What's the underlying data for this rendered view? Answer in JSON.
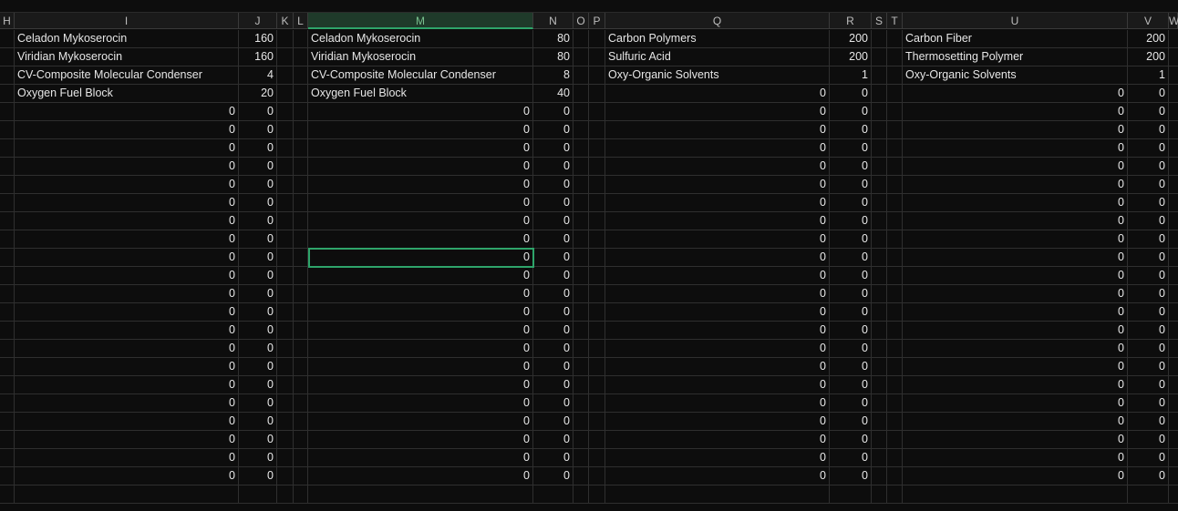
{
  "columns": [
    {
      "letter": "H",
      "active": false
    },
    {
      "letter": "I",
      "active": false
    },
    {
      "letter": "J",
      "active": false
    },
    {
      "letter": "K",
      "active": false
    },
    {
      "letter": "L",
      "active": false
    },
    {
      "letter": "M",
      "active": true
    },
    {
      "letter": "N",
      "active": false
    },
    {
      "letter": "O",
      "active": false
    },
    {
      "letter": "P",
      "active": false
    },
    {
      "letter": "Q",
      "active": false
    },
    {
      "letter": "R",
      "active": false
    },
    {
      "letter": "S",
      "active": false
    },
    {
      "letter": "T",
      "active": false
    },
    {
      "letter": "U",
      "active": false
    },
    {
      "letter": "V",
      "active": false
    },
    {
      "letter": "W",
      "active": false
    }
  ],
  "rows": [
    [
      "",
      "Celadon Mykoserocin",
      "160",
      "",
      "",
      "Celadon Mykoserocin",
      "80",
      "",
      "",
      "Carbon Polymers",
      "200",
      "",
      "",
      "Carbon Fiber",
      "200",
      ""
    ],
    [
      "",
      "Viridian Mykoserocin",
      "160",
      "",
      "",
      "Viridian Mykoserocin",
      "80",
      "",
      "",
      "Sulfuric Acid",
      "200",
      "",
      "",
      "Thermosetting Polymer",
      "200",
      ""
    ],
    [
      "",
      "CV-Composite Molecular Condenser",
      "4",
      "",
      "",
      "CV-Composite Molecular Condenser",
      "8",
      "",
      "",
      "Oxy-Organic Solvents",
      "1",
      "",
      "",
      "Oxy-Organic Solvents",
      "1",
      ""
    ],
    [
      "",
      "Oxygen Fuel Block",
      "20",
      "",
      "",
      "Oxygen Fuel Block",
      "40",
      "",
      "",
      "0",
      "0",
      "",
      "",
      "0",
      "0",
      ""
    ],
    [
      "",
      "0",
      "0",
      "",
      "",
      "0",
      "0",
      "",
      "",
      "0",
      "0",
      "",
      "",
      "0",
      "0",
      ""
    ],
    [
      "",
      "0",
      "0",
      "",
      "",
      "0",
      "0",
      "",
      "",
      "0",
      "0",
      "",
      "",
      "0",
      "0",
      ""
    ],
    [
      "",
      "0",
      "0",
      "",
      "",
      "0",
      "0",
      "",
      "",
      "0",
      "0",
      "",
      "",
      "0",
      "0",
      ""
    ],
    [
      "",
      "0",
      "0",
      "",
      "",
      "0",
      "0",
      "",
      "",
      "0",
      "0",
      "",
      "",
      "0",
      "0",
      ""
    ],
    [
      "",
      "0",
      "0",
      "",
      "",
      "0",
      "0",
      "",
      "",
      "0",
      "0",
      "",
      "",
      "0",
      "0",
      ""
    ],
    [
      "",
      "0",
      "0",
      "",
      "",
      "0",
      "0",
      "",
      "",
      "0",
      "0",
      "",
      "",
      "0",
      "0",
      ""
    ],
    [
      "",
      "0",
      "0",
      "",
      "",
      "0",
      "0",
      "",
      "",
      "0",
      "0",
      "",
      "",
      "0",
      "0",
      ""
    ],
    [
      "",
      "0",
      "0",
      "",
      "",
      "0",
      "0",
      "",
      "",
      "0",
      "0",
      "",
      "",
      "0",
      "0",
      ""
    ],
    [
      "",
      "0",
      "0",
      "",
      "",
      "0",
      "0",
      "",
      "",
      "0",
      "0",
      "",
      "",
      "0",
      "0",
      ""
    ],
    [
      "",
      "0",
      "0",
      "",
      "",
      "0",
      "0",
      "",
      "",
      "0",
      "0",
      "",
      "",
      "0",
      "0",
      ""
    ],
    [
      "",
      "0",
      "0",
      "",
      "",
      "0",
      "0",
      "",
      "",
      "0",
      "0",
      "",
      "",
      "0",
      "0",
      ""
    ],
    [
      "",
      "0",
      "0",
      "",
      "",
      "0",
      "0",
      "",
      "",
      "0",
      "0",
      "",
      "",
      "0",
      "0",
      ""
    ],
    [
      "",
      "0",
      "0",
      "",
      "",
      "0",
      "0",
      "",
      "",
      "0",
      "0",
      "",
      "",
      "0",
      "0",
      ""
    ],
    [
      "",
      "0",
      "0",
      "",
      "",
      "0",
      "0",
      "",
      "",
      "0",
      "0",
      "",
      "",
      "0",
      "0",
      ""
    ],
    [
      "",
      "0",
      "0",
      "",
      "",
      "0",
      "0",
      "",
      "",
      "0",
      "0",
      "",
      "",
      "0",
      "0",
      ""
    ],
    [
      "",
      "0",
      "0",
      "",
      "",
      "0",
      "0",
      "",
      "",
      "0",
      "0",
      "",
      "",
      "0",
      "0",
      ""
    ],
    [
      "",
      "0",
      "0",
      "",
      "",
      "0",
      "0",
      "",
      "",
      "0",
      "0",
      "",
      "",
      "0",
      "0",
      ""
    ],
    [
      "",
      "0",
      "0",
      "",
      "",
      "0",
      "0",
      "",
      "",
      "0",
      "0",
      "",
      "",
      "0",
      "0",
      ""
    ],
    [
      "",
      "0",
      "0",
      "",
      "",
      "0",
      "0",
      "",
      "",
      "0",
      "0",
      "",
      "",
      "0",
      "0",
      ""
    ],
    [
      "",
      "0",
      "0",
      "",
      "",
      "0",
      "0",
      "",
      "",
      "0",
      "0",
      "",
      "",
      "0",
      "0",
      ""
    ],
    [
      "",
      "0",
      "0",
      "",
      "",
      "0",
      "0",
      "",
      "",
      "0",
      "0",
      "",
      "",
      "0",
      "0",
      ""
    ],
    [
      "",
      "",
      "",
      "",
      "",
      "",
      "",
      "",
      "",
      "",
      "",
      "",
      "",
      "",
      "",
      ""
    ]
  ],
  "selected_cell": {
    "column": "M",
    "row_index": 12
  },
  "colors": {
    "background": "#0d0d0d",
    "header_bg": "#1a1a1a",
    "gridline": "#2f2f2f",
    "accent": "#2ea46a",
    "text": "#e6e6e6"
  }
}
